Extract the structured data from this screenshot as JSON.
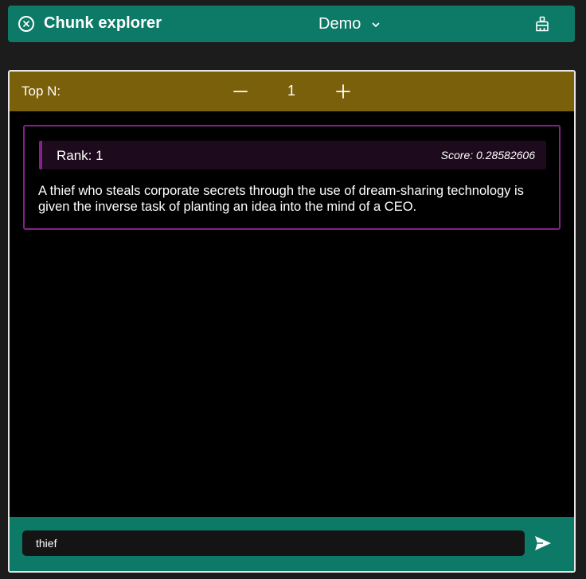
{
  "header": {
    "title": "Chunk explorer",
    "dataset": "Demo",
    "close_icon": "close-circle-icon",
    "dropdown_icon": "chevron-down-icon",
    "clear_icon": "broom-icon"
  },
  "topn": {
    "label": "Top N:",
    "value": "1",
    "minus_icon": "minus-icon",
    "plus_icon": "plus-icon"
  },
  "results": [
    {
      "rank": "Rank: 1",
      "score": "Score: 0.28582606",
      "text": "A thief who steals corporate secrets through the use of dream-sharing technology is given the inverse task of planting an idea into the mind of a CEO."
    }
  ],
  "query": {
    "value": "thief",
    "send_icon": "send-icon"
  },
  "colors": {
    "header": "#0c7a66",
    "topn_bar": "#7a600a",
    "card_border": "#86208a",
    "card_head": "#1d0a1c",
    "background": "#1c1c1c"
  }
}
